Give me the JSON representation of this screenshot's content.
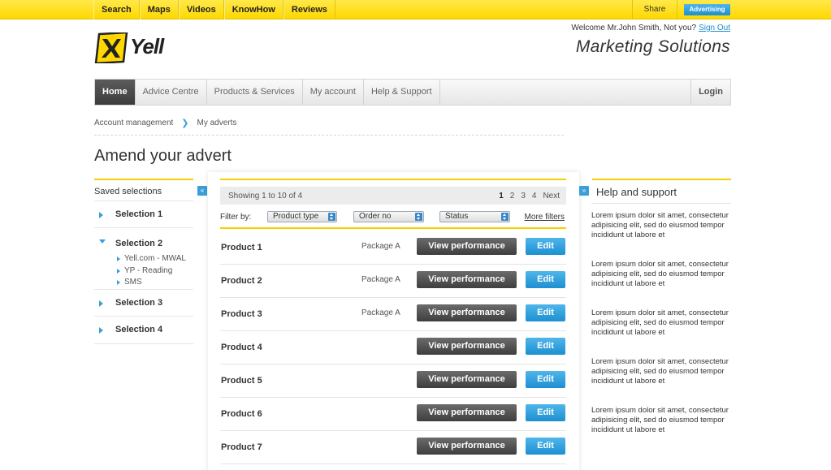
{
  "topbar": {
    "links": [
      "Search",
      "Maps",
      "Videos",
      "KnowHow",
      "Reviews"
    ],
    "share": "Share",
    "advertising": "Advertising"
  },
  "header": {
    "logo_text": "Yell",
    "welcome": "Welcome Mr.John Smith, Not you?",
    "sign_out": "Sign Out",
    "title": "Marketing Solutions"
  },
  "nav": {
    "items": [
      "Home",
      "Advice Centre",
      "Products & Services",
      "My account",
      "Help & Support"
    ],
    "login": "Login"
  },
  "breadcrumb": {
    "items": [
      "Account management",
      "My adverts"
    ]
  },
  "page_title": "Amend your advert",
  "sidebar": {
    "title": "Saved selections",
    "selections": [
      {
        "label": "Selection 1"
      },
      {
        "label": "Selection 2",
        "subs": [
          "Yell.com - MWAL",
          "YP - Reading",
          "SMS"
        ]
      },
      {
        "label": "Selection 3"
      },
      {
        "label": "Selection 4"
      }
    ]
  },
  "results": {
    "showing": "Showing 1 to 10 of 4",
    "pages": [
      "1",
      "2",
      "3",
      "4"
    ],
    "next": "Next"
  },
  "filters": {
    "label": "Filter by:",
    "selects": [
      "Product type",
      "Order no",
      "Status"
    ],
    "more": "More filters"
  },
  "products": [
    {
      "name": "Product 1",
      "package": "Package A",
      "view": "View performance",
      "edit": "Edit"
    },
    {
      "name": "Product 2",
      "package": "Package A",
      "view": "View performance",
      "edit": "Edit"
    },
    {
      "name": "Product 3",
      "package": "Package A",
      "view": "View performance",
      "edit": "Edit"
    },
    {
      "name": "Product 4",
      "package": "",
      "view": "View performance",
      "edit": "Edit"
    },
    {
      "name": "Product 5",
      "package": "",
      "view": "View performance",
      "edit": "Edit"
    },
    {
      "name": "Product 6",
      "package": "",
      "view": "View performance",
      "edit": "Edit"
    },
    {
      "name": "Product 7",
      "package": "",
      "view": "View performance",
      "edit": "Edit"
    }
  ],
  "help": {
    "title": "Help and support",
    "paragraphs": [
      "Lorem ipsum dolor sit amet, consectetur adipisicing elit, sed do eiusmod tempor incididunt ut labore et",
      "Lorem ipsum dolor sit amet, consectetur adipisicing elit, sed do eiusmod tempor incididunt ut labore et",
      "Lorem ipsum dolor sit amet, consectetur adipisicing elit, sed do eiusmod tempor incididunt ut labore et",
      "Lorem ipsum dolor sit amet, consectetur adipisicing elit, sed do eiusmod tempor incididunt ut labore et",
      "Lorem ipsum dolor sit amet, consectetur adipisicing elit, sed do eiusmod tempor incididunt ut labore et"
    ]
  },
  "colors": {
    "brand_yellow": "#ffd800",
    "accent_blue": "#1d8fd1",
    "dark_button": "#3e3e3e"
  }
}
